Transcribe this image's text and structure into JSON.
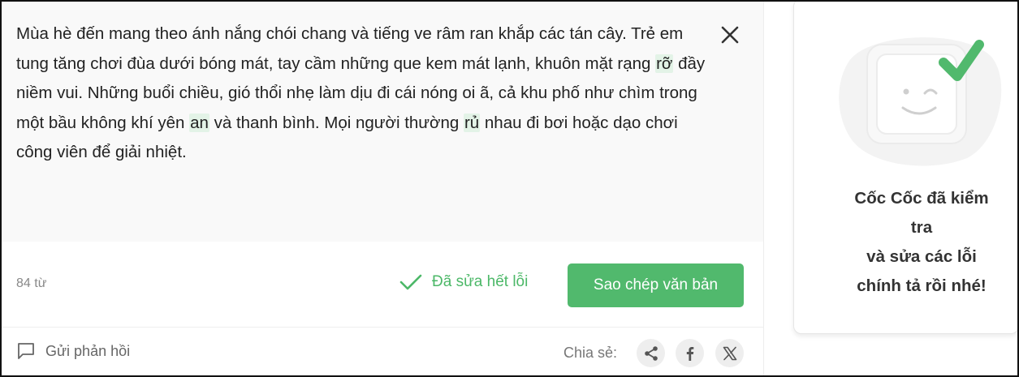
{
  "editor": {
    "text_segments": [
      {
        "text": "Mùa hè đến mang theo ánh nắng chói chang và tiếng ve râm ran khắp các tán cây. Trẻ em tung tăng chơi đùa dưới bóng mát, tay cầm những que kem mát lạnh, khuôn mặt rạng ",
        "corrected": false
      },
      {
        "text": "rỡ",
        "corrected": true
      },
      {
        "text": " đầy niềm vui. Những buổi chiều, gió thổi nhẹ làm dịu đi cái nóng oi ã, cả khu phố như chìm trong một bầu không khí yên ",
        "corrected": false
      },
      {
        "text": "an",
        "corrected": true
      },
      {
        "text": " và thanh bình. Mọi người thường ",
        "corrected": false
      },
      {
        "text": "rủ",
        "corrected": true
      },
      {
        "text": " nhau đi bơi hoặc dạo chơi công viên để giải nhiệt.",
        "corrected": false
      }
    ],
    "close_icon": "close-icon",
    "highlight_color": "#e3f3e7"
  },
  "toolbar": {
    "word_count": "84 từ",
    "status_label": "Đã sửa hết lỗi",
    "status_icon": "checkmark-icon",
    "copy_label": "Sao chép văn bản",
    "accent_color": "#51b96d"
  },
  "footer": {
    "feedback_label": "Gửi phản hồi",
    "feedback_icon": "chat-bubble-icon",
    "share_label": "Chia sẻ:",
    "share_icons": [
      "share-icon",
      "facebook-icon",
      "x-icon"
    ]
  },
  "panel": {
    "message_lines": [
      "Cốc Cốc đã kiểm",
      "tra",
      "và sửa các lỗi",
      "chính tả rồi nhé!"
    ],
    "illustration": "winking-face-checkmark-icon"
  }
}
